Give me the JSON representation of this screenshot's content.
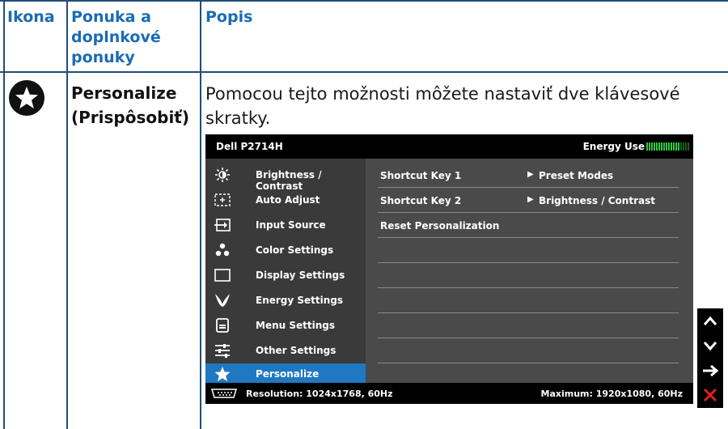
{
  "table": {
    "headers": [
      "Ikona",
      "Ponuka a doplnkové ponuky",
      "Popis"
    ],
    "header_lines_col2": [
      "Ponuka a",
      "doplnkové",
      "ponuky"
    ],
    "row": {
      "icon": "star-icon",
      "menu_line1": "Personalize",
      "menu_line2": "(Prispôsobiť)",
      "desc_line1": "Pomocou tejto možnosti môžete nastaviť dve klávesové",
      "desc_line2": "skratky."
    }
  },
  "osd": {
    "title": "Dell P2714H",
    "energy_label": "Energy Use",
    "energy_level": 0.8,
    "menu": [
      {
        "label": "Brightness / Contrast",
        "icon": "brightness-icon"
      },
      {
        "label": "Auto Adjust",
        "icon": "auto-adjust-icon"
      },
      {
        "label": "Input Source",
        "icon": "input-source-icon"
      },
      {
        "label": "Color Settings",
        "icon": "color-settings-icon"
      },
      {
        "label": "Display Settings",
        "icon": "display-settings-icon"
      },
      {
        "label": "Energy Settings",
        "icon": "energy-settings-icon"
      },
      {
        "label": "Menu Settings",
        "icon": "menu-settings-icon"
      },
      {
        "label": "Other Settings",
        "icon": "other-settings-icon"
      },
      {
        "label": "Personalize",
        "icon": "star-icon",
        "active": true
      }
    ],
    "submenu": [
      {
        "label": "Shortcut Key 1",
        "value": "Preset Modes"
      },
      {
        "label": "Shortcut Key 2",
        "value": "Brightness / Contrast"
      },
      {
        "label": "Reset Personalization",
        "value": ""
      }
    ],
    "resolution": "Resolution: 1024x1768, 60Hz",
    "maximum": "Maximum: 1920x1080, 60Hz"
  },
  "buttons": [
    {
      "name": "up-button",
      "icon": "chevron-up-icon"
    },
    {
      "name": "down-button",
      "icon": "chevron-down-icon"
    },
    {
      "name": "enter-button",
      "icon": "arrow-right-icon"
    },
    {
      "name": "exit-button",
      "icon": "close-icon"
    }
  ],
  "colors": {
    "header_text": "#1a6bb5",
    "grid": "#1f4e79",
    "active_menu": "#1f78c1",
    "energy_on": "#2ecc40",
    "energy_off": "#1a5e20",
    "exit": "#e02020"
  }
}
